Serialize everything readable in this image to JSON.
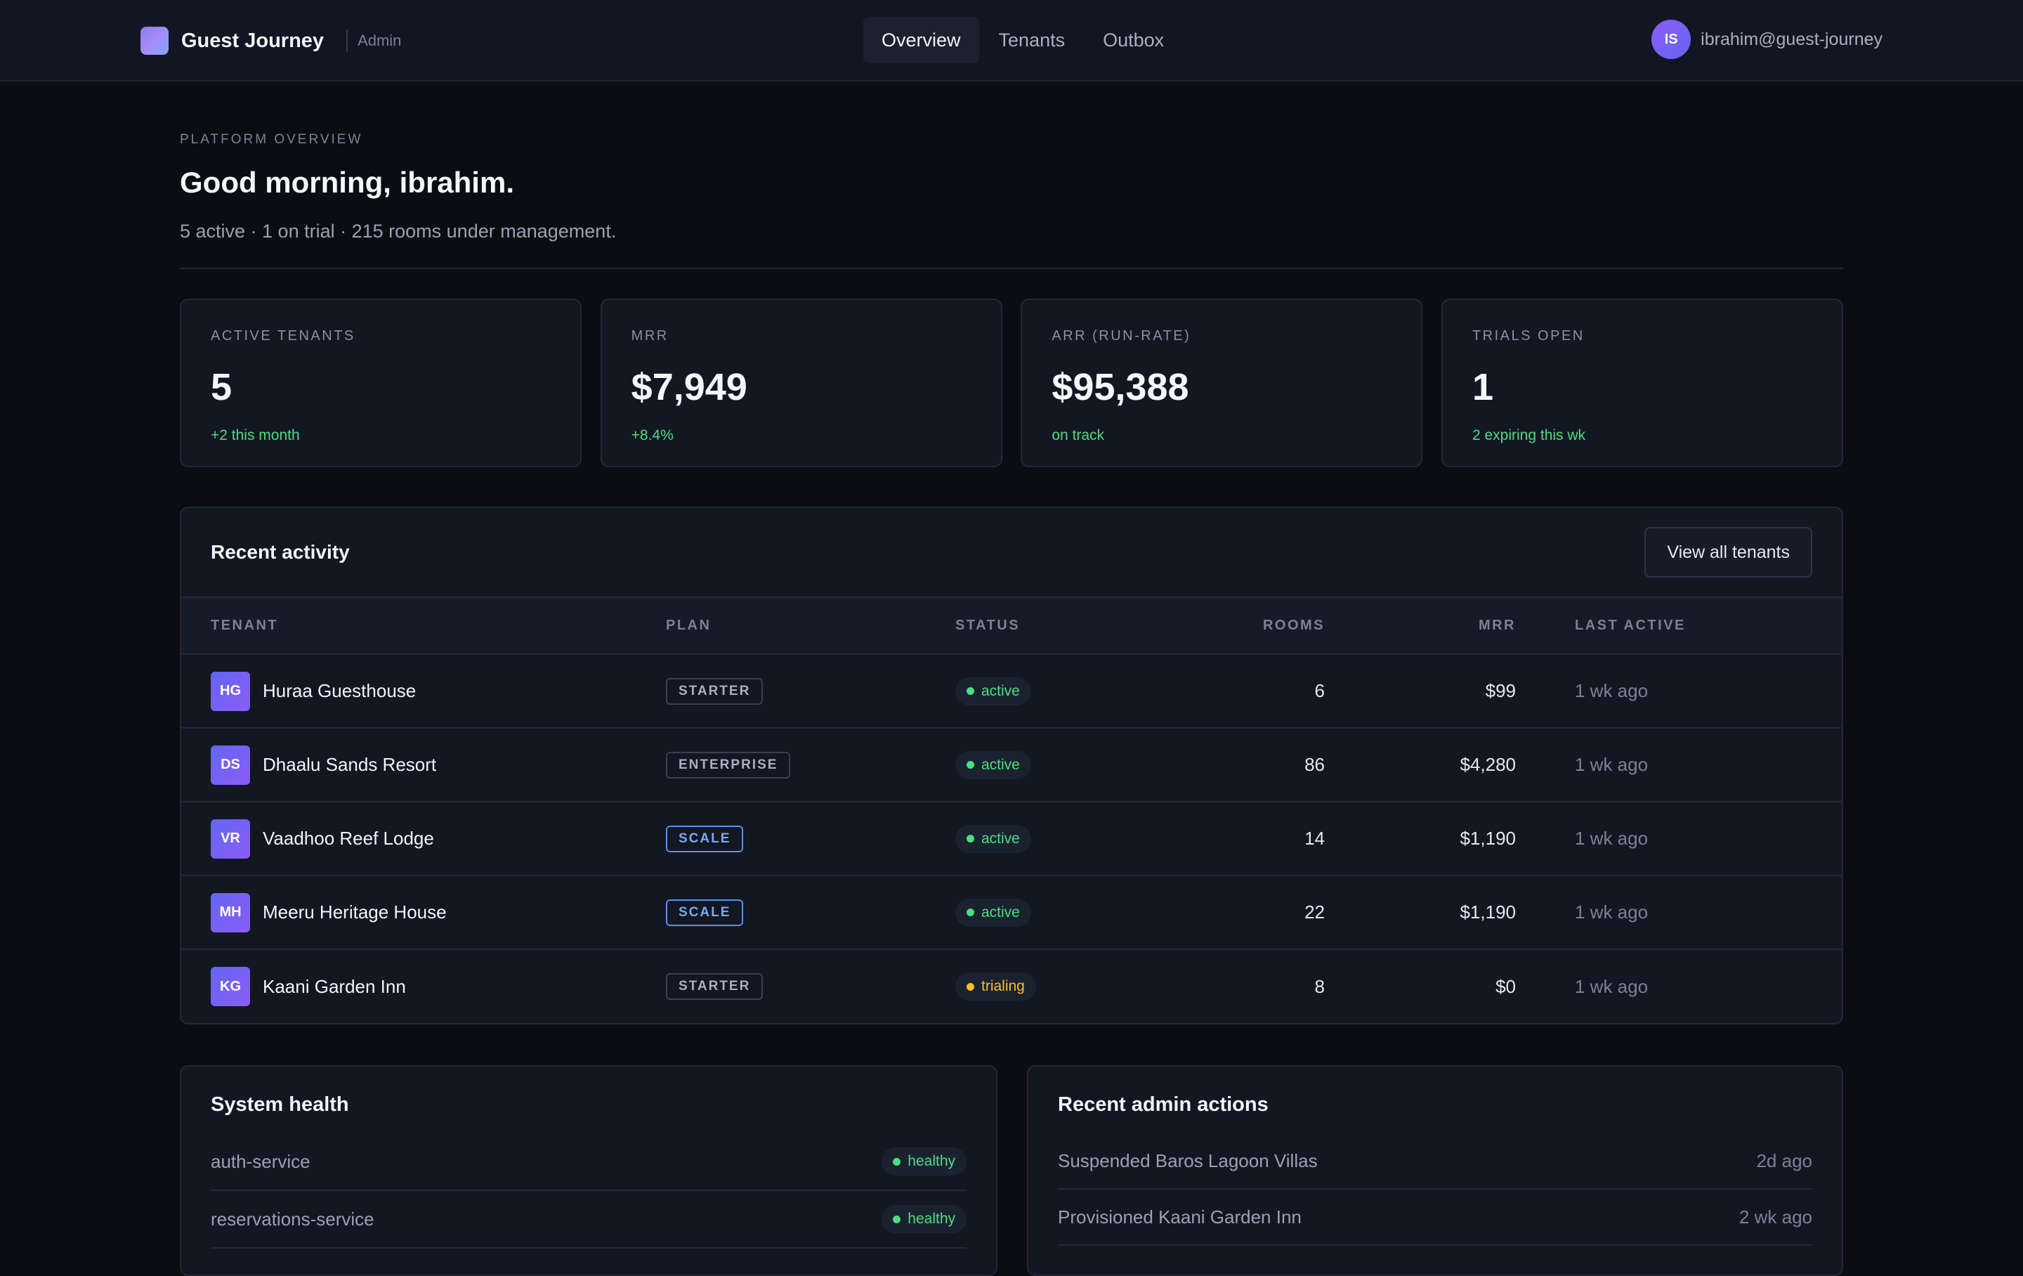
{
  "header": {
    "brand_name": "Guest Journey",
    "brand_tag": "Admin",
    "nav": [
      {
        "label": "Overview",
        "active": true
      },
      {
        "label": "Tenants",
        "active": false
      },
      {
        "label": "Outbox",
        "active": false
      }
    ],
    "user": {
      "initials": "IS",
      "email": "ibrahim@guest-journey"
    }
  },
  "hero": {
    "eyebrow": "PLATFORM OVERVIEW",
    "greeting": "Good morning, ibrahim.",
    "summary": "5 active · 1 on trial · 215 rooms under management."
  },
  "kpis": [
    {
      "label": "ACTIVE TENANTS",
      "value": "5",
      "delta": "+2 this month"
    },
    {
      "label": "MRR",
      "value": "$7,949",
      "delta": "+8.4%"
    },
    {
      "label": "ARR (RUN-RATE)",
      "value": "$95,388",
      "delta": "on track"
    },
    {
      "label": "TRIALS OPEN",
      "value": "1",
      "delta": "2 expiring this wk"
    }
  ],
  "activity": {
    "title": "Recent activity",
    "view_all_label": "View all tenants",
    "columns": {
      "tenant": "TENANT",
      "plan": "PLAN",
      "status": "STATUS",
      "rooms": "ROOMS",
      "mrr": "MRR",
      "last_active": "LAST ACTIVE"
    },
    "rows": [
      {
        "initials": "HG",
        "name": "Huraa Guesthouse",
        "plan": "STARTER",
        "status": "active",
        "rooms": "6",
        "mrr": "$99",
        "last_active": "1 wk ago"
      },
      {
        "initials": "DS",
        "name": "Dhaalu Sands Resort",
        "plan": "ENTERPRISE",
        "status": "active",
        "rooms": "86",
        "mrr": "$4,280",
        "last_active": "1 wk ago"
      },
      {
        "initials": "VR",
        "name": "Vaadhoo Reef Lodge",
        "plan": "SCALE",
        "status": "active",
        "rooms": "14",
        "mrr": "$1,190",
        "last_active": "1 wk ago"
      },
      {
        "initials": "MH",
        "name": "Meeru Heritage House",
        "plan": "SCALE",
        "status": "active",
        "rooms": "22",
        "mrr": "$1,190",
        "last_active": "1 wk ago"
      },
      {
        "initials": "KG",
        "name": "Kaani Garden Inn",
        "plan": "STARTER",
        "status": "trialing",
        "rooms": "8",
        "mrr": "$0",
        "last_active": "1 wk ago"
      }
    ]
  },
  "system_health": {
    "title": "System health",
    "services": [
      {
        "name": "auth-service",
        "status": "healthy"
      },
      {
        "name": "reservations-service",
        "status": "healthy"
      }
    ]
  },
  "admin_actions": {
    "title": "Recent admin actions",
    "items": [
      {
        "text": "Suspended Baros Lagoon Villas",
        "time": "2d ago"
      },
      {
        "text": "Provisioned Kaani Garden Inn",
        "time": "2 wk ago"
      }
    ]
  },
  "colors": {
    "background": "#0b0d12",
    "panel": "#131722",
    "accent": "#8b5cf6",
    "success": "#4ade80",
    "warning": "#fbbf24",
    "scale_badge": "#7aa7f7"
  }
}
